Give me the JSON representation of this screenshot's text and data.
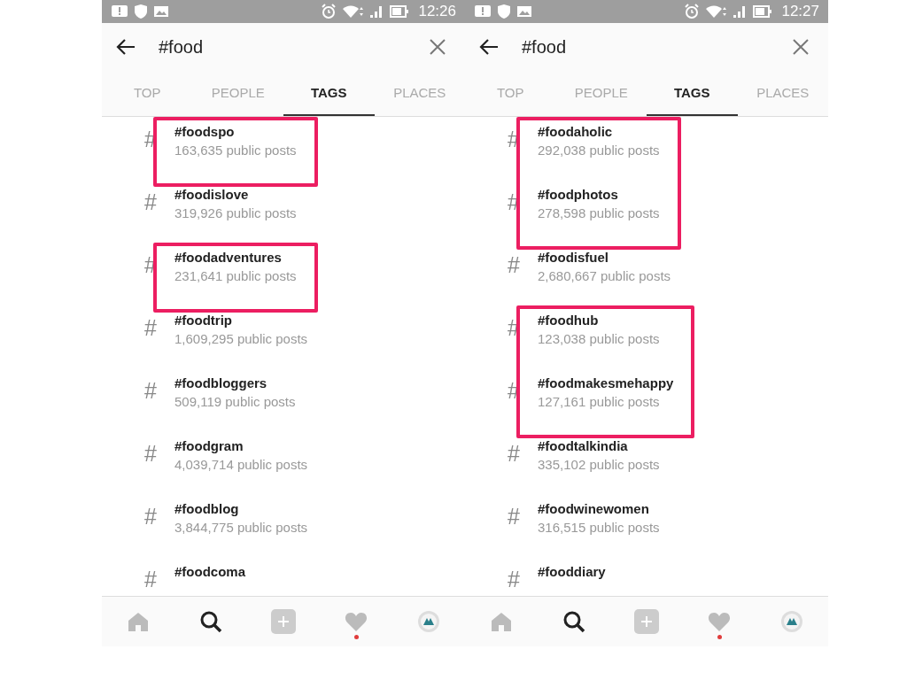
{
  "screens": [
    {
      "status_bar": {
        "time": "12:26"
      },
      "search": {
        "value": "#food"
      },
      "tag_symbol": "#",
      "tabs": [
        {
          "label": "TOP",
          "selected": false
        },
        {
          "label": "PEOPLE",
          "selected": false
        },
        {
          "label": "TAGS",
          "selected": true
        },
        {
          "label": "PLACES",
          "selected": false
        }
      ],
      "results": [
        {
          "tag": "#foodspo",
          "posts": "163,635 public posts",
          "highlighted": true
        },
        {
          "tag": "#foodislove",
          "posts": "319,926 public posts",
          "highlighted": false
        },
        {
          "tag": "#foodadventures",
          "posts": "231,641 public posts",
          "highlighted": true
        },
        {
          "tag": "#foodtrip",
          "posts": "1,609,295 public posts",
          "highlighted": false
        },
        {
          "tag": "#foodbloggers",
          "posts": "509,119 public posts",
          "highlighted": false
        },
        {
          "tag": "#foodgram",
          "posts": "4,039,714 public posts",
          "highlighted": false
        },
        {
          "tag": "#foodblog",
          "posts": "3,844,775 public posts",
          "highlighted": false
        },
        {
          "tag": "#foodcoma",
          "highlighted": false
        }
      ],
      "nav": [
        {
          "selected": false
        },
        {
          "selected": true
        },
        {
          "selected": false
        },
        {
          "selected": false,
          "notification": true
        },
        {
          "selected": false
        }
      ]
    },
    {
      "status_bar": {
        "time": "12:27"
      },
      "search": {
        "value": "#food"
      },
      "tag_symbol": "#",
      "tabs": [
        {
          "label": "TOP",
          "selected": false
        },
        {
          "label": "PEOPLE",
          "selected": false
        },
        {
          "label": "TAGS",
          "selected": true
        },
        {
          "label": "PLACES",
          "selected": false
        }
      ],
      "results": [
        {
          "tag": "#foodaholic",
          "posts": "292,038 public posts",
          "highlighted": true
        },
        {
          "tag": "#foodphotos",
          "posts": "278,598 public posts",
          "highlighted": true
        },
        {
          "tag": "#foodisfuel",
          "posts": "2,680,667 public posts",
          "highlighted": false
        },
        {
          "tag": "#foodhub",
          "posts": "123,038 public posts",
          "highlighted": true
        },
        {
          "tag": "#foodmakesmehappy",
          "posts": "127,161 public posts",
          "highlighted": true
        },
        {
          "tag": "#foodtalkindia",
          "posts": "335,102 public posts",
          "highlighted": false
        },
        {
          "tag": "#foodwinewomen",
          "posts": "316,515 public posts",
          "highlighted": false
        },
        {
          "tag": "#fooddiary",
          "highlighted": false
        }
      ],
      "nav": [
        {
          "selected": false
        },
        {
          "selected": true
        },
        {
          "selected": false
        },
        {
          "selected": false,
          "notification": true
        },
        {
          "selected": false
        }
      ]
    }
  ]
}
